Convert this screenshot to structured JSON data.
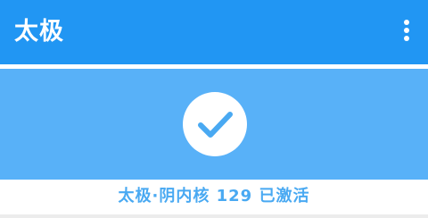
{
  "appbar": {
    "title": "太极",
    "overflow_icon": "more-vert-icon",
    "color": "#2196f3"
  },
  "status": {
    "icon": "check-icon",
    "card_color": "#58b1f8",
    "text": "太极·阴内核 129 已激活",
    "text_color": "#49a9f2"
  }
}
